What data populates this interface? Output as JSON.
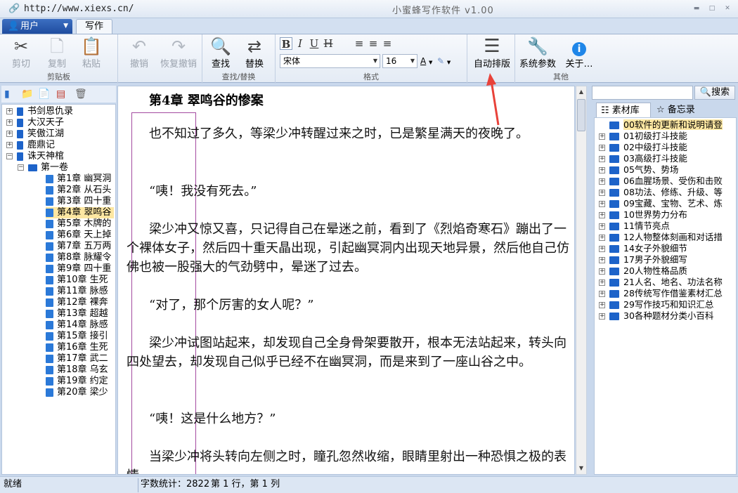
{
  "window": {
    "url": "http://www.xiexs.cn/",
    "title": "小蜜蜂写作软件  v1.00"
  },
  "tabs": {
    "user_label": "用户",
    "write_label": "写作"
  },
  "ribbon": {
    "clipboard": {
      "cut": "剪切",
      "copy": "复制",
      "paste": "粘贴",
      "label": "剪贴板"
    },
    "undo": {
      "undo": "撤销",
      "redo": "恢复撤销"
    },
    "find": {
      "find": "查找",
      "replace": "替换",
      "label": "查找/替换"
    },
    "format": {
      "font": "宋体",
      "size": "16",
      "label": "格式"
    },
    "layout": {
      "auto": "自动排版"
    },
    "other": {
      "settings": "系统参数",
      "about": "关于…",
      "label": "其他"
    }
  },
  "tree": {
    "books": [
      "书剑恩仇录",
      "大汉天子",
      "笑傲江湖",
      "鹿鼎记",
      "诛天神棺"
    ],
    "volume": "第一卷",
    "chapters": [
      "第1章 幽冥洞",
      "第2章 从石头",
      "第3章 四十重",
      "第4章 翠鸣谷",
      "第5章 木牌的",
      "第6章 天上掉",
      "第7章 五万两",
      "第8章 脉耀令",
      "第9章 四十重",
      "第10章 生死",
      "第11章 脉感",
      "第12章 裸奔",
      "第13章 超越",
      "第14章 脉感",
      "第15章 接引",
      "第16章 生死",
      "第17章 武二",
      "第18章 乌玄",
      "第19章 约定",
      "第20章 梁少"
    ]
  },
  "editor": {
    "chapter_title": "第4章  翠鸣谷的惨案",
    "paragraphs": [
      "也不知过了多久，等梁少冲转醒过来之时，已是繁星满天的夜晚了。",
      "“咦！我没有死去。”",
      "梁少冲又惊又喜，只记得自己在晕迷之前，看到了《烈焰奇寒石》蹦出了一个裸体女子，然后四十重天晶出现，引起幽冥洞内出现天地异景，然后他自己仿佛也被一股强大的气劲劈中，晕迷了过去。",
      "“对了，那个厉害的女人呢？”",
      "梁少冲试图站起来，却发现自己全身骨架要散开，根本无法站起来，转头向四处望去，却发现自己似乎已经不在幽冥洞，而是来到了一座山谷之中。",
      "“咦！这是什么地方？”",
      "当梁少冲将头转向左侧之时，瞳孔忽然收缩，眼睛里射出一种恐惧之极的表情。"
    ]
  },
  "right_panel": {
    "search_button": "搜索",
    "tab_materials": "素材库",
    "tab_memo": "备忘录",
    "items": [
      "00软件的更新和说明请登",
      "01初级打斗技能",
      "02中级打斗技能",
      "03高级打斗技能",
      "05气势、势场",
      "06血腥场景、受伤和击败",
      "08功法、修练、升级、等",
      "09宝藏、宝物、艺术、炼",
      "10世界势力分布",
      "11情节亮点",
      "12人物整体刻画和对话措",
      "14女子外貌细节",
      "17男子外貌细写",
      "20人物性格品质",
      "21人名、地名、功法名称",
      "28传统写作借鉴素材汇总",
      "29写作技巧和知识汇总",
      "30各种题材分类小百科"
    ]
  },
  "status": {
    "ready": "就绪",
    "word_count": "字数统计：2822",
    "position": "第 1 行，第 1 列"
  },
  "colors": {
    "accent": "#1d63c9",
    "arrow": "#e8423a",
    "selection": "#fde7a2"
  }
}
